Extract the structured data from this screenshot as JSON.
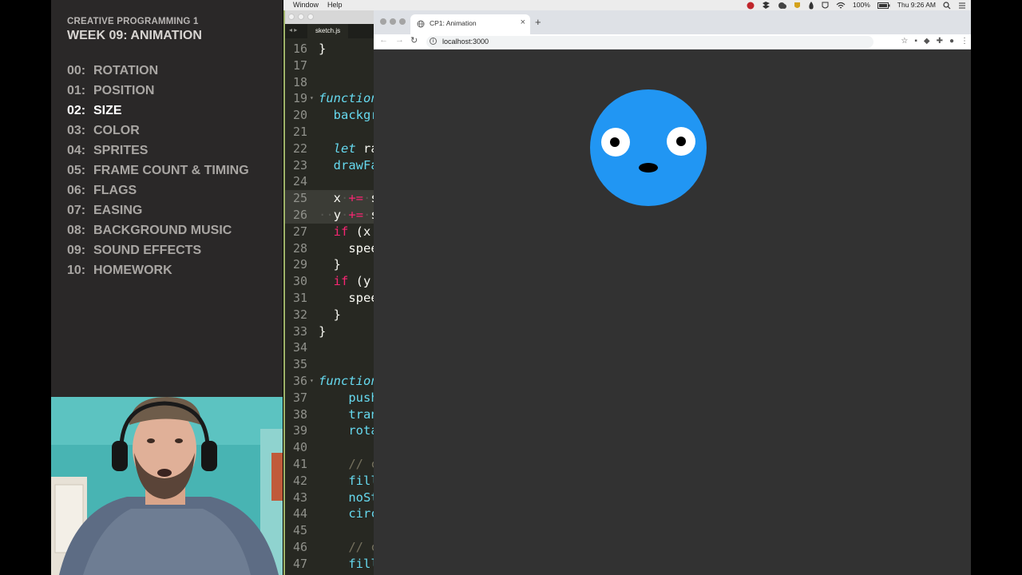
{
  "course": {
    "subtitle": "CREATIVE PROGRAMMING 1",
    "title": "WEEK 09: ANIMATION",
    "lessons": [
      {
        "num": "00:",
        "label": "ROTATION"
      },
      {
        "num": "01:",
        "label": "POSITION"
      },
      {
        "num": "02:",
        "label": "SIZE"
      },
      {
        "num": "03:",
        "label": "COLOR"
      },
      {
        "num": "04:",
        "label": "SPRITES"
      },
      {
        "num": "05:",
        "label": "FRAME COUNT & TIMING"
      },
      {
        "num": "06:",
        "label": "FLAGS"
      },
      {
        "num": "07:",
        "label": "EASING"
      },
      {
        "num": "08:",
        "label": "BACKGROUND MUSIC"
      },
      {
        "num": "09:",
        "label": "SOUND EFFECTS"
      },
      {
        "num": "10:",
        "label": "HOMEWORK"
      }
    ],
    "active_lesson": "02:",
    "active_color": "#ffffff"
  },
  "menubar": {
    "window": "Window",
    "help": "Help",
    "battery": "100%",
    "clock": "Thu 9:26 AM"
  },
  "editor": {
    "tab_arrows": "◂ ▸",
    "file_tab": "sketch.js",
    "lines": [
      {
        "n": "16",
        "text": "}"
      },
      {
        "n": "17",
        "text": ""
      },
      {
        "n": "18",
        "text": ""
      },
      {
        "n": "19",
        "text": "function"
      },
      {
        "n": "20",
        "text": "  backgr"
      },
      {
        "n": "21",
        "text": ""
      },
      {
        "n": "22",
        "text": "  let ra"
      },
      {
        "n": "23",
        "text": "  drawFa"
      },
      {
        "n": "24",
        "text": ""
      },
      {
        "n": "25",
        "text": "  x·+=·s"
      },
      {
        "n": "26",
        "text": "··y·+=·s"
      },
      {
        "n": "27",
        "text": "  if (x"
      },
      {
        "n": "28",
        "text": "    spee"
      },
      {
        "n": "29",
        "text": "  }"
      },
      {
        "n": "30",
        "text": "  if (y"
      },
      {
        "n": "31",
        "text": "    spee"
      },
      {
        "n": "32",
        "text": "  }"
      },
      {
        "n": "33",
        "text": "}"
      },
      {
        "n": "34",
        "text": ""
      },
      {
        "n": "35",
        "text": ""
      },
      {
        "n": "36",
        "text": "function"
      },
      {
        "n": "37",
        "text": "    push"
      },
      {
        "n": "38",
        "text": "    tran"
      },
      {
        "n": "39",
        "text": "    rota"
      },
      {
        "n": "40",
        "text": ""
      },
      {
        "n": "41",
        "text": "    // c"
      },
      {
        "n": "42",
        "text": "    fill"
      },
      {
        "n": "43",
        "text": "    noSt"
      },
      {
        "n": "44",
        "text": "    circ"
      },
      {
        "n": "45",
        "text": ""
      },
      {
        "n": "46",
        "text": "    // c"
      },
      {
        "n": "47",
        "text": "    fill"
      }
    ]
  },
  "browser": {
    "tab_title": "CP1: Animation",
    "tab_close": "×",
    "new_tab": "+",
    "back": "←",
    "forward": "→",
    "reload": "↻",
    "info": "i",
    "url": "localhost:3000",
    "toolbar_icons": [
      "star-icon",
      "extension-icon",
      "shield-extension-icon",
      "puzzle-icon",
      "profile-icon",
      "more-icon"
    ],
    "toolbar_glyphs": [
      "☆",
      "▪",
      "◆",
      "✚",
      "●",
      "⋮"
    ],
    "background": "#323232"
  },
  "sketch": {
    "face_color": "#2196f3",
    "eye_color": "#ffffff",
    "pupil_color": "#000000",
    "mouth_color": "#000000"
  }
}
